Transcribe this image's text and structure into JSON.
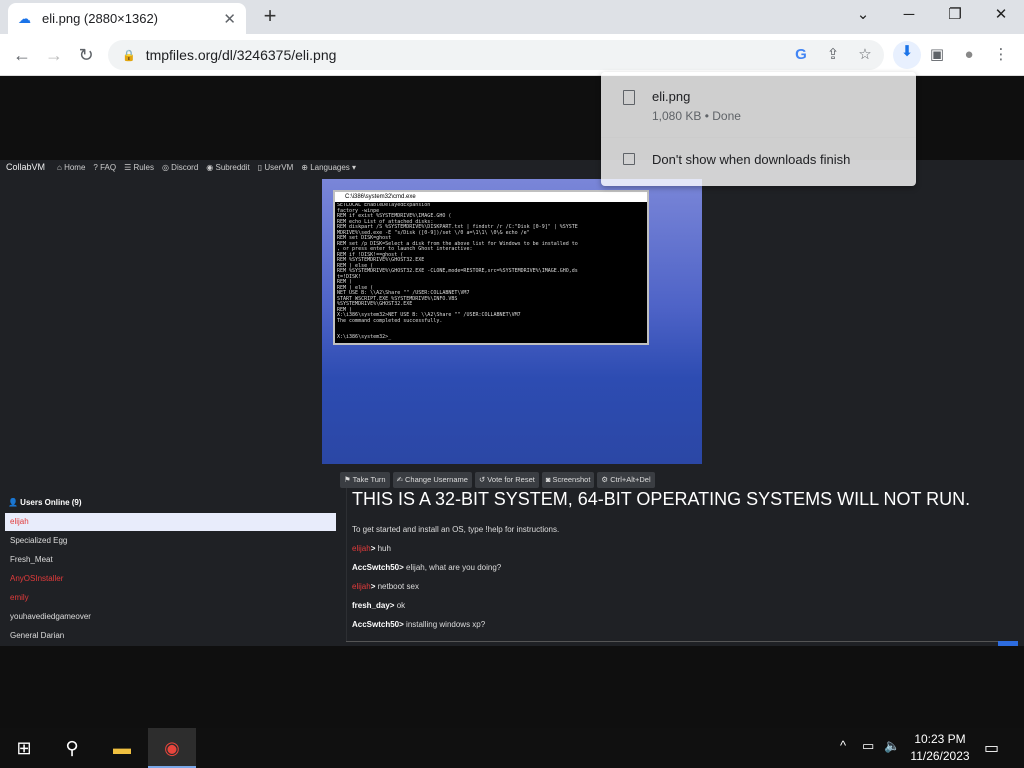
{
  "browser": {
    "tab_title": "eli.png (2880×1362)",
    "tab_close": "✕",
    "new_tab": "+",
    "url": "tmpfiles.org/dl/3246375/eli.png",
    "window_minimize": "─",
    "window_restore": "❐",
    "window_close": "✕",
    "back": "←",
    "forward": "→",
    "reload": "↻",
    "g_icon": "G",
    "share": "⇪",
    "star": "☆",
    "download": "⬇",
    "sidepanel": "▣",
    "profile": "●",
    "menu": "⋮",
    "expand": "⌄"
  },
  "download_popup": {
    "file_name": "eli.png",
    "file_status": "1,080 KB • Done",
    "dont_show_label": "Don't show when downloads finish"
  },
  "site": {
    "brand": "CollabVM",
    "nav": [
      "⌂ Home",
      "? FAQ",
      "☰ Rules",
      "◎ Discord",
      "◉ Subreddit",
      "▯ UserVM",
      "⊕ Languages ▾"
    ],
    "cmd_title": "C:\\i386\\system32\\cmd.exe",
    "cmd_text": "SETLOCAL EnableDelayedExpansion\nfactory -winpe\nREM if exist %SYSTEMDRIVE%\\IMAGE.GHO (\nREM echo List of attached disks:\nREM diskpart /S %SYSTEMDRIVE%\\DISKPART.txt | findstr /r /C:\"Disk [0-9]\" | %SYSTE\nMDRIVE%\\sed.exe -E \"s/Disk ([0-9])/set \\/0 a=\\1\\1\\ \\0\\& echo /e\"\nREM set DISK=ghost\nREM set /p DISK=Select a disk from the above list for Windows to be installed to\n, or press enter to launch Ghost interactive:\nREM if !DISK!==ghost (\nREM %SYSTEMDRIVE%\\GHOST32.EXE\nREM ) else (\nREM %SYSTEMDRIVE%\\GHOST32.EXE -CLONE,mode=RESTORE,src=%SYSTEMDRIVE%\\IMAGE.GHO,ds\nt=!DISK!\nREM )\nREM ) else (\nNET USE B: \\\\A2\\Share \"\" /USER:COLLABNET\\VM7\nSTART WSCRIPT.EXE %SYSTEMDRIVE%\\INFO.VBS\n%SYSTEMDRIVE%\\GHOST32.EXE\nREM )\nX:\\i386\\system32>NET USE B: \\\\A2\\Share \"\" /USER:COLLABNET\\VM7\nThe command completed successfully.\n\n\nX:\\i386\\system32>_",
    "vm_buttons": [
      "⚑ Take Turn",
      "✍ Change Username",
      "↺ Vote for Reset",
      "◙ Screenshot",
      "⚙ Ctrl+Alt+Del"
    ],
    "users_header": "👤 Users Online (9)",
    "users": [
      {
        "name": "elijah",
        "color": "#e23b3b",
        "selected": true
      },
      {
        "name": "Specialized Egg",
        "color": "#dddddd"
      },
      {
        "name": "Fresh_Meat",
        "color": "#dddddd"
      },
      {
        "name": "AnyOSInstaller",
        "color": "#e23b3b"
      },
      {
        "name": "emily",
        "color": "#e23b3b"
      },
      {
        "name": "youhavediedgameover",
        "color": "#dddddd"
      },
      {
        "name": "General Darian",
        "color": "#dddddd"
      }
    ],
    "chat_banner": "THIS IS A 32-BIT SYSTEM, 64-BIT OPERATING SYSTEMS WILL NOT RUN.",
    "chat_intro": "To get started and install an OS, type !help for instructions.",
    "chat": [
      {
        "user": "elijah",
        "msg": " huh",
        "red": true
      },
      {
        "user": "AccSwtch50",
        "msg": " elijah, what are you doing?",
        "red": false
      },
      {
        "user": "elijah",
        "msg": " netboot sex",
        "red": true
      },
      {
        "user": "fresh_day",
        "msg": " ok",
        "red": false
      },
      {
        "user": "AccSwtch50",
        "msg": " installing windows xp?",
        "red": false
      }
    ]
  },
  "taskbar": {
    "start": "⊞",
    "search": "⚲",
    "explorer": "▬",
    "chrome": "◉",
    "time": "10:23 PM",
    "date": "11/26/2023",
    "tray_chevron": "^",
    "tray_network": "▭",
    "tray_volume": "🔈",
    "notifications": "▭"
  }
}
